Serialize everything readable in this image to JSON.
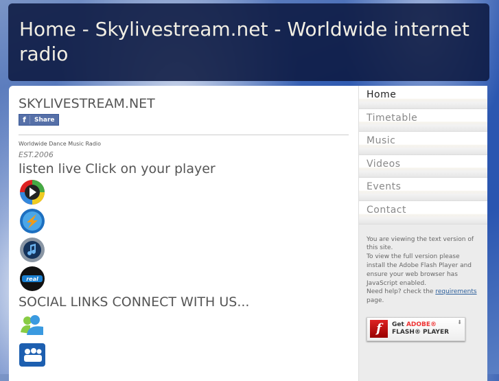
{
  "header": {
    "title": "Home - Skylivestream.net - Worldwide internet radio"
  },
  "main": {
    "site_title": "SKYLIVESTREAM.NET",
    "share": {
      "icon": "facebook-icon",
      "label": "Share"
    },
    "tagline": "Worldwide Dance Music Radio",
    "est": "EST.2006",
    "listen_heading": "listen live Click on your player",
    "players": [
      {
        "icon": "windows-media-player-icon"
      },
      {
        "icon": "winamp-icon"
      },
      {
        "icon": "itunes-icon"
      },
      {
        "icon": "realplayer-icon"
      }
    ],
    "social_heading": "SOCIAL LINKS CONNECT WITH US...",
    "social": [
      {
        "icon": "msn-messenger-icon"
      },
      {
        "icon": "myspace-icon"
      }
    ]
  },
  "sidebar": {
    "menu": [
      {
        "label": "Home"
      },
      {
        "label": "Timetable"
      },
      {
        "label": "Music"
      },
      {
        "label": "Videos"
      },
      {
        "label": "Events"
      },
      {
        "label": "Contact"
      }
    ],
    "note": {
      "line1": "You are viewing the text version of this site.",
      "line2": "To view the full version please install the Adobe Flash Player and ensure your web browser has JavaScript enabled.",
      "help_prefix": "Need help? check the ",
      "help_link": "requirements",
      "help_suffix": " page."
    },
    "flash": {
      "get": "Get",
      "adobe": "ADOBE®",
      "player": "FLASH® PLAYER"
    }
  }
}
